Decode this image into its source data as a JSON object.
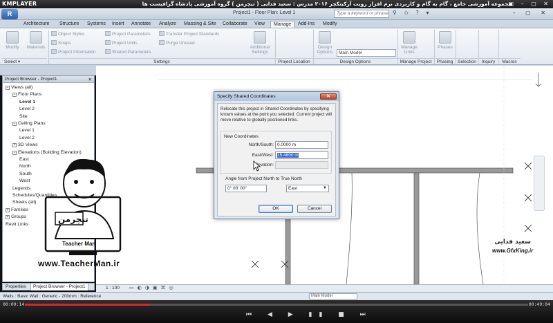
{
  "player": {
    "logo": "KMPLAYER",
    "title": "مجموعه آموزشی جامع ، گام به گام و کاربردی نرم افزار رویت آرکیتکچر ۲۰۱۶  مدرس : سعید فدایی ( تیچرمن ) گروه آموزشی پادشاه گرافیست ها",
    "window_controls": "▣ – ▢ ✕",
    "time_elapsed": "00:09:14",
    "time_total": "00:49:04",
    "progress": 0.25,
    "controls": "⏮ ◀ ▶ ▮▮ ■ ⏭"
  },
  "revit": {
    "app_button": "R",
    "doc_title": "Project1 - Floor Plan: Level 1",
    "search_placeholder": "Type a keyword or phrase",
    "top_icons": "⚲ ✩ ? ▾",
    "window_controls": "– ▢ ✕"
  },
  "ribbon": {
    "tabs": [
      "Architecture",
      "Structure",
      "Systems",
      "Insert",
      "Annotate",
      "Analyze",
      "Massing & Site",
      "Collaborate",
      "View",
      "Manage",
      "Add-Ins",
      "Modify"
    ],
    "active_tab": "Manage",
    "modify_label": "Modify",
    "materials_label": "Materials",
    "settings_items": [
      "Object Styles",
      "Snaps",
      "Project Information",
      "Project Parameters",
      "Project Units",
      "Shared Parameters",
      "Transfer Project Standards",
      "Purge Unused"
    ],
    "additional_settings": "Additional Settings",
    "design_options_label": "Design Options",
    "main_model": "Main Model",
    "manage_links": "Manage Links",
    "phases": "Phases",
    "panels": [
      "Select ▾",
      "Settings",
      "Project Location",
      "Design Options",
      "Manage Project",
      "Phasing",
      "Selection",
      "Inquiry",
      "Macros"
    ]
  },
  "project_browser": {
    "title": "Project Browser - Project1",
    "close": "✕",
    "tree": [
      {
        "label": "Views (all)",
        "toggle": "−"
      },
      {
        "label": "Floor Plans",
        "toggle": "−"
      },
      {
        "label": "Level 1",
        "bold": true
      },
      {
        "label": "Level 2"
      },
      {
        "label": "Site"
      },
      {
        "label": "Ceiling Plans",
        "toggle": "−"
      },
      {
        "label": "Level 1"
      },
      {
        "label": "Level 2"
      },
      {
        "label": "3D Views",
        "toggle": "+"
      },
      {
        "label": "Elevations (Building Elevation)",
        "toggle": "−"
      },
      {
        "label": "East"
      },
      {
        "label": "North"
      },
      {
        "label": "South"
      },
      {
        "label": "West"
      },
      {
        "label": "Legends"
      },
      {
        "label": "Schedules/Quantities"
      },
      {
        "label": "Sheets (all)"
      },
      {
        "label": "Families",
        "toggle": "+"
      },
      {
        "label": "Groups",
        "toggle": "+"
      },
      {
        "label": "Revit Links"
      }
    ],
    "tabs": [
      "Properties",
      "Project Browser - Project1"
    ]
  },
  "dialog": {
    "title": "Specify Shared Coordinates",
    "close": "✕",
    "description": "Relocate this project in Shared Coordinates by specifying known values at the point you selected. Current project will move relative to globally positioned links.",
    "group_title": "New Coordinates",
    "north_south_label": "North/South:",
    "north_south_value": "0.0000 m",
    "east_west_label": "East/West:",
    "east_west_value": "15.4800 m",
    "elevation_label": "Elevation:",
    "angle_label": "Angle from Project North to True North",
    "angle_value": "0° 00' 00\"",
    "direction_value": "East",
    "ok": "OK",
    "cancel": "Cancel"
  },
  "view_control": {
    "scale": "1 : 100"
  },
  "status_bar": {
    "text": "Walls : Basic Wall : Generic - 200mm : Reference",
    "model": "Main Model"
  },
  "overlays": {
    "teacher_url": "www.TeacherMan.ir",
    "teacher_name": "Teacher Man",
    "teacher_logo_fa": "تیچرمن",
    "signature_fa": "سعید فدایی",
    "gfx_url": "www.GfxKing.ir"
  }
}
